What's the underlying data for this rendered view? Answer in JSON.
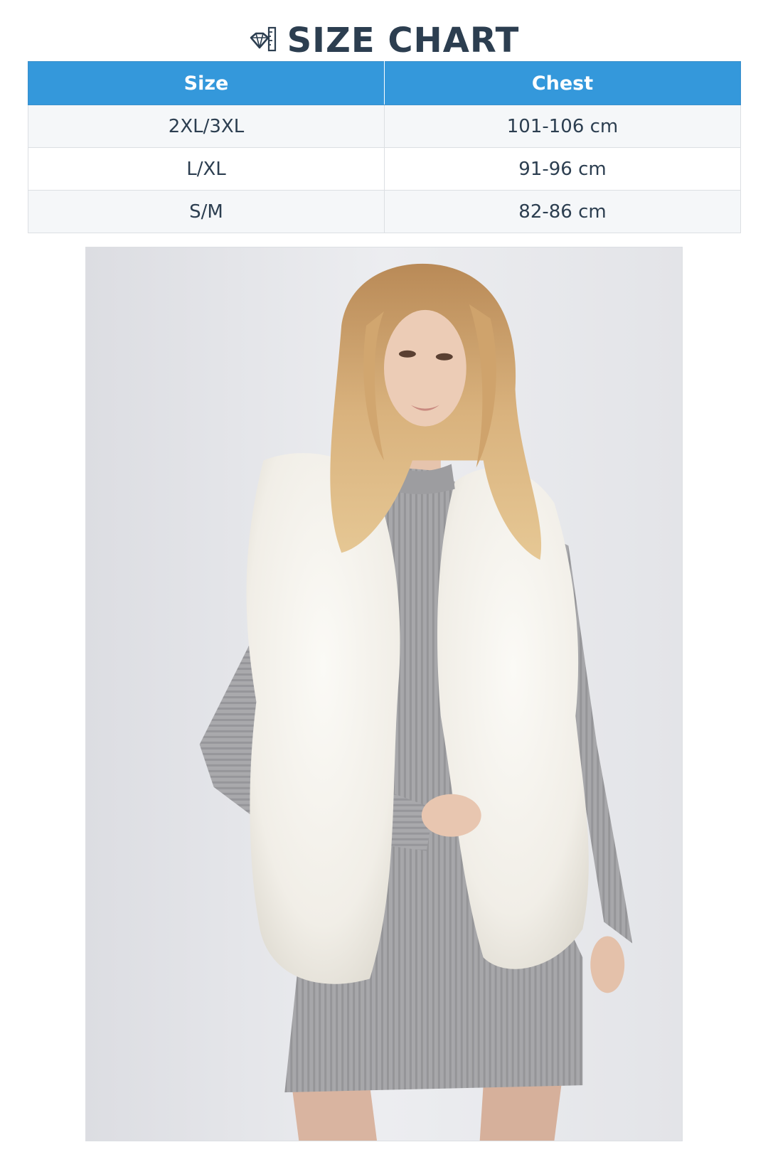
{
  "header": {
    "title": "SIZE CHART",
    "icon": "ruler-icon"
  },
  "table": {
    "columns": [
      "Size",
      "Chest"
    ],
    "rows": [
      [
        "2XL/3XL",
        "101-106 cm"
      ],
      [
        "L/XL",
        "91-96 cm"
      ],
      [
        "S/M",
        "82-86 cm"
      ]
    ]
  },
  "colors": {
    "header_bg": "#3498db",
    "title_text": "#2c3e50",
    "row_alt": "#f5f7f9"
  },
  "product_image": {
    "subject": "model wearing white faux fur vest over grey ribbed knit dress"
  }
}
